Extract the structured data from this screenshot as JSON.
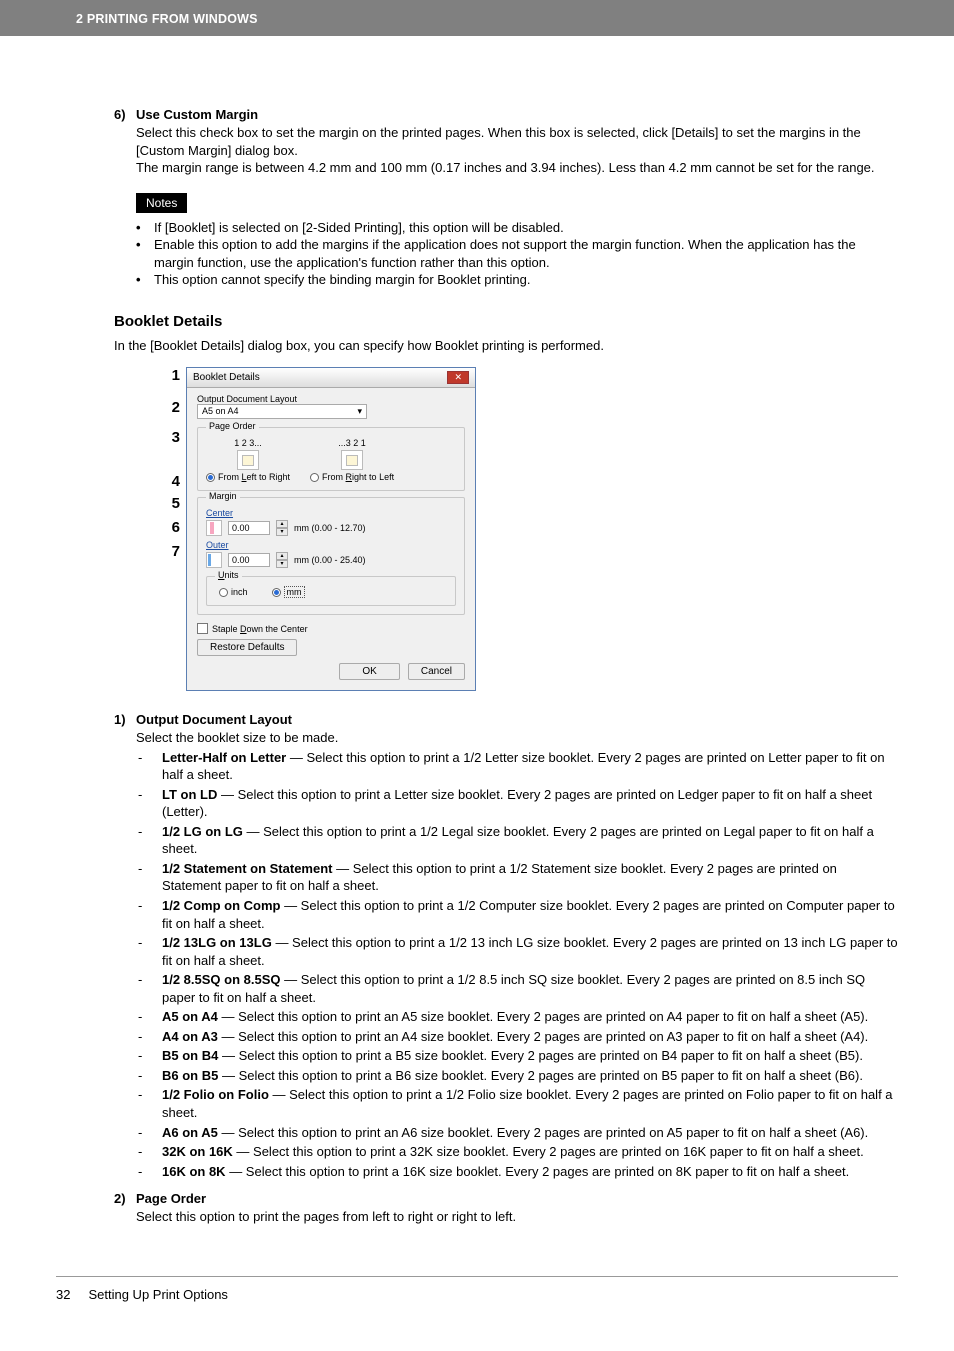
{
  "header": {
    "section": "2 PRINTING FROM WINDOWS"
  },
  "item6": {
    "num": "6)",
    "title": "Use Custom Margin",
    "p1": "Select this check box to set the margin on the printed pages. When this box is selected, click [Details] to set the margins in the [Custom Margin] dialog box.",
    "p2": "The margin range is between 4.2 mm and 100 mm (0.17 inches and 3.94 inches). Less than 4.2 mm cannot be set for the range."
  },
  "notes": {
    "label": "Notes",
    "n1": "If [Booklet] is selected on [2-Sided Printing], this option will be disabled.",
    "n2": "Enable this option to add the margins if the application does not support the margin function. When the application has the margin function, use the application's function rather than this option.",
    "n3": "This option cannot specify the binding margin for Booklet printing."
  },
  "bookletHeading": "Booklet Details",
  "bookletIntro": "In the [Booklet Details] dialog box, you can specify how Booklet printing is performed.",
  "callouts": [
    "1",
    "2",
    "3",
    "4",
    "5",
    "6",
    "7"
  ],
  "dialog": {
    "title": "Booklet Details",
    "layoutLabel": "Output Document Layout",
    "layoutValue": "A5 on A4",
    "pageOrderLabel": "Page Order",
    "leftNum": "1 2 3...",
    "rightNum": "...3 2 1",
    "fromLtoR": "From Left to Right",
    "fromRtoL": "From Right to Left",
    "marginLabel": "Margin",
    "centerLabel": "Center",
    "centerVal": "0.00",
    "centerRange": "mm (0.00 - 12.70)",
    "outerLabel": "Outer",
    "outerVal": "0.00",
    "outerRange": "mm (0.00 - 25.40)",
    "unitsLabel": "Units",
    "unitInch": "inch",
    "unitMm": "mm",
    "stapleLabel": "Staple Down the Center",
    "restore": "Restore Defaults",
    "ok": "OK",
    "cancel": "Cancel"
  },
  "item1": {
    "num": "1)",
    "title": "Output Document Layout",
    "intro": "Select the booklet size to be made.",
    "opts": [
      {
        "name": "Letter-Half on Letter",
        "desc": " — Select this option to print a 1/2 Letter size booklet. Every 2 pages are printed on Letter paper to fit on half a sheet."
      },
      {
        "name": "LT on LD",
        "desc": " — Select this option to print a Letter size booklet. Every 2 pages are printed on Ledger paper to fit on half a sheet (Letter)."
      },
      {
        "name": "1/2 LG on LG",
        "desc": " — Select this option to print a 1/2 Legal size booklet. Every 2 pages are printed on Legal paper to fit on half a sheet."
      },
      {
        "name": "1/2 Statement on Statement",
        "desc": " — Select this option to print a 1/2 Statement size booklet. Every 2 pages are printed on Statement paper to fit on half a sheet."
      },
      {
        "name": "1/2 Comp on Comp",
        "desc": " — Select this option to print a 1/2 Computer size booklet. Every 2 pages are printed on Computer paper to fit on half a sheet."
      },
      {
        "name": "1/2 13LG on 13LG",
        "desc": " — Select this option to print a 1/2 13 inch LG size booklet. Every 2 pages are printed on 13 inch LG paper to fit on half a sheet."
      },
      {
        "name": "1/2 8.5SQ on 8.5SQ",
        "desc": " — Select this option to print a 1/2 8.5 inch SQ size booklet. Every 2 pages are printed on 8.5 inch SQ paper to fit on half a sheet."
      },
      {
        "name": "A5 on A4",
        "desc": " — Select this option to print an A5 size booklet. Every 2 pages are printed on A4 paper to fit on half a sheet (A5)."
      },
      {
        "name": "A4 on A3",
        "desc": " — Select this option to print an A4 size booklet. Every 2 pages are printed on A3 paper to fit on half a sheet (A4)."
      },
      {
        "name": "B5 on B4",
        "desc": " — Select this option to print a B5 size booklet. Every 2 pages are printed on B4 paper to fit on half a sheet (B5)."
      },
      {
        "name": "B6 on B5",
        "desc": " — Select this option to print a B6 size booklet. Every 2 pages are printed on B5 paper to fit on half a sheet (B6)."
      },
      {
        "name": "1/2 Folio on Folio",
        "desc": " — Select this option to print a 1/2 Folio size booklet. Every 2 pages are printed on Folio paper to fit on half a sheet."
      },
      {
        "name": "A6 on A5",
        "desc": " — Select this option to print an A6 size booklet. Every 2 pages are printed on A5 paper to fit on half a sheet (A6)."
      },
      {
        "name": "32K on 16K",
        "desc": " — Select this option to print a 32K size booklet. Every 2 pages are printed on 16K paper to fit on half a sheet."
      },
      {
        "name": "16K on 8K",
        "desc": " — Select this option to print a 16K size booklet. Every 2 pages are printed on 8K paper to fit on half a sheet."
      }
    ]
  },
  "item2": {
    "num": "2)",
    "title": "Page Order",
    "intro": "Select this option to print the pages from left to right or right to left."
  },
  "footer": {
    "page": "32",
    "title": "Setting Up Print Options"
  }
}
